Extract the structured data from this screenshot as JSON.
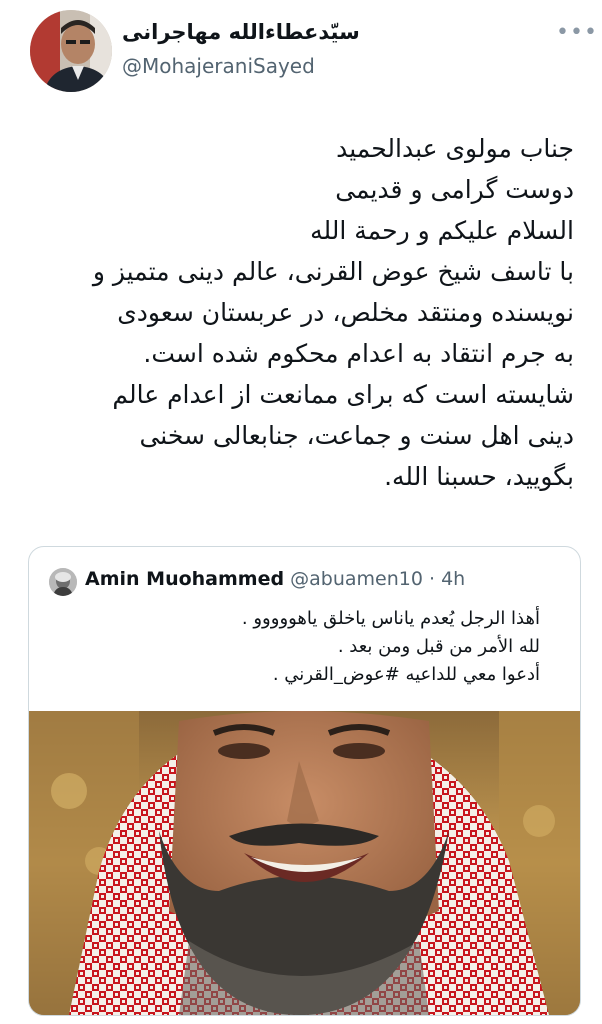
{
  "tweet": {
    "author": {
      "display_name": "سیّدعطاءالله مهاجرانی",
      "handle": "@MohajeraniSayed"
    },
    "more_icon": "ellipsis-icon",
    "text_lines": [
      "جناب مولوی عبدالحمید",
      "دوست گرامی و قدیمی",
      "السلام علیکم و رحمة الله",
      "با تاسف شیخ عوض القرنی، عالم دینی متمیز و",
      "نویسنده ومنتقد مخلص، در عربستان سعودی",
      "به جرم انتقاد به اعدام محکوم شده است.",
      "شایسته است که برای ممانعت از اعدام عالم",
      "دینی اهل سنت و جماعت، جنابعالی سخنی",
      "بگویید، حسبنا الله."
    ]
  },
  "quote": {
    "author": {
      "display_name": "Amin Muohammed",
      "handle": "@abuamen10",
      "separator": "·",
      "time": "4h"
    },
    "text_lines": [
      "أهذا الرجل يُعدم ياناس ياخلق ياهووووو .",
      "لله الأمر من قبل ومن بعد .",
      "أدعوا معي للداعيه #عوض_القرني ."
    ],
    "colors": {
      "keffiyeh_red": "#c8161e",
      "keffiyeh_white": "#f4efe8",
      "background_gold": "#b5893b",
      "skin": "#b77b56",
      "beard": "#3a3733"
    }
  }
}
